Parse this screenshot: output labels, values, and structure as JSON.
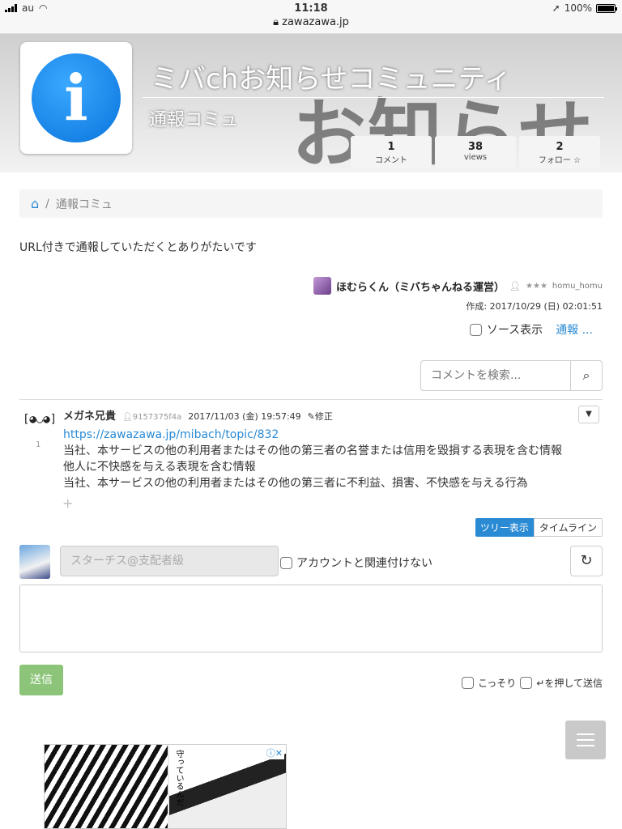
{
  "statusbar": {
    "carrier": "au",
    "time": "11:18",
    "url": "zawazawa.jp",
    "battery": "100%"
  },
  "header": {
    "bg_word": "お知らせ",
    "logo_glyph": "i",
    "title": "ミバchお知らせコミュニティ",
    "subtitle": "通報コミュ",
    "stats": [
      {
        "value": "1",
        "label": "コメント"
      },
      {
        "value": "38",
        "label": "views"
      },
      {
        "value": "2",
        "label": "フォロー ☆"
      }
    ]
  },
  "breadcrumb": {
    "home_icon": "home-icon",
    "separator": "/",
    "current": "通報コミュ"
  },
  "description": "URL付きで通報していただくとありがたいです",
  "topic": {
    "author": "ほむらくん（ミバちゃんねる運営）",
    "stars": "★★★",
    "author_id": "homu_homu",
    "created": "作成: 2017/10/29 (日) 02:01:51",
    "source_label": "ソース表示",
    "report_label": "通報 ..."
  },
  "search": {
    "placeholder": "コメントを検索..."
  },
  "comment": {
    "avatar_text": "[◕◡◕]",
    "number": "1",
    "name": "メガネ兄貴",
    "uid": "9157375f4a",
    "datetime": "2017/11/03 (金) 19:57:49",
    "edit_label": "修正",
    "link": "https://zawazawa.jp/mibach/topic/832",
    "lines": [
      "当社、本サービスの他の利用者またはその他の第三者の名誉または信用を毀損する表現を含む情報",
      "他人に不快感を与える表現を含む情報",
      "当社、本サービスの他の利用者またはその他の第三者に不利益、損害、不快感を与える行為"
    ],
    "plus": "+"
  },
  "view_toggle": {
    "tree": "ツリー表示",
    "timeline": "タイムライン"
  },
  "post_form": {
    "name_placeholder": "スターチス@支配者級",
    "no_account_label": "アカウントと関連付けない",
    "send_label": "送信",
    "secret_label": "こっそり",
    "enter_send_label": "↵を押して送信"
  },
  "ad": {
    "text": "守っているんだ",
    "badge": "ⓘ✕"
  },
  "colors": {
    "accent": "#2a8ad4",
    "send": "#8cc47a"
  }
}
